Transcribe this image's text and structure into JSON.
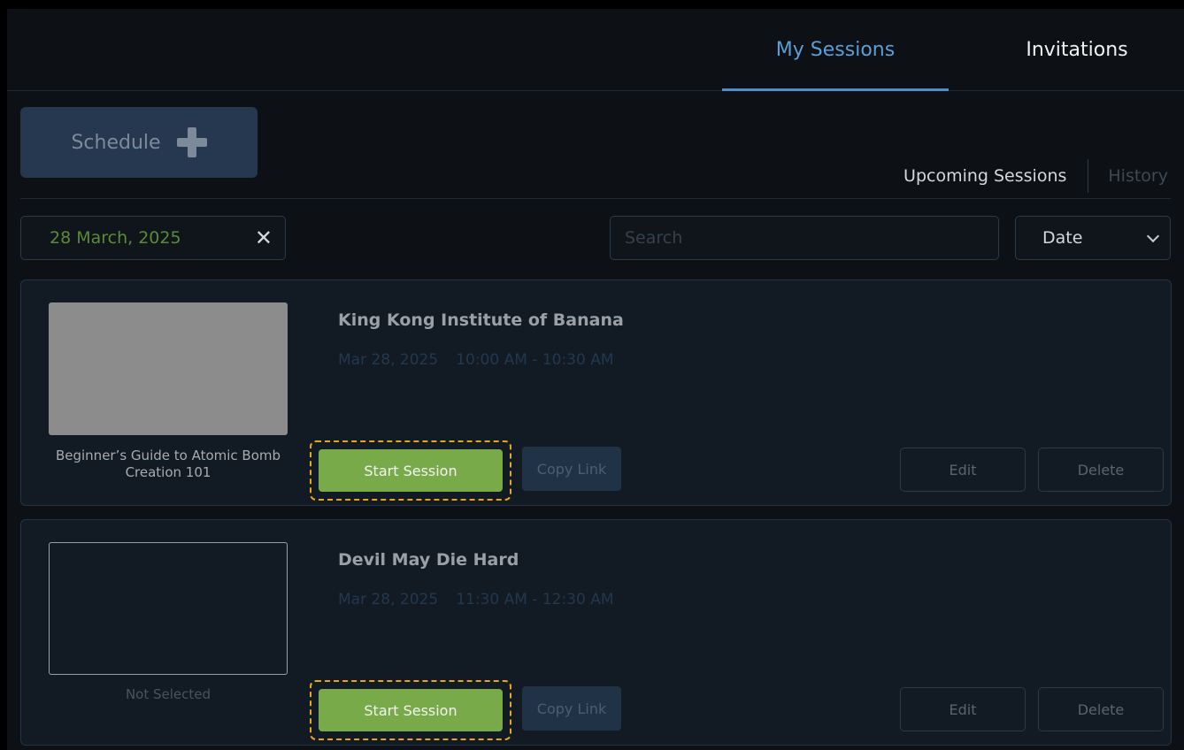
{
  "nav": {
    "tabs": [
      {
        "label": "My Sessions"
      },
      {
        "label": "Invitations"
      }
    ]
  },
  "toolbar": {
    "schedule_label": "Schedule"
  },
  "subtabs": {
    "upcoming": "Upcoming Sessions",
    "history": "History"
  },
  "filters": {
    "date_chip": "28 March, 2025",
    "search_placeholder": "Search",
    "sort_value": "Date"
  },
  "sessions": [
    {
      "title": "King Kong Institute of Banana",
      "date": "Mar 28, 2025",
      "time": "10:00 AM - 10:30 AM",
      "caption": "Beginner’s Guide to Atomic Bomb Creation 101",
      "start_label": "Start Session",
      "copy_label": "Copy Link",
      "edit_label": "Edit",
      "delete_label": "Delete"
    },
    {
      "title": "Devil May Die Hard",
      "date": "Mar 28, 2025",
      "time": "11:30 AM - 12:30 AM",
      "caption": "Not Selected",
      "start_label": "Start Session",
      "copy_label": "Copy Link",
      "edit_label": "Edit",
      "delete_label": "Delete"
    }
  ],
  "colors": {
    "accent_blue": "#4d8fd1",
    "start_green": "#78aa4a",
    "highlight_orange": "#e6a817",
    "date_green": "#5b8a3a"
  }
}
